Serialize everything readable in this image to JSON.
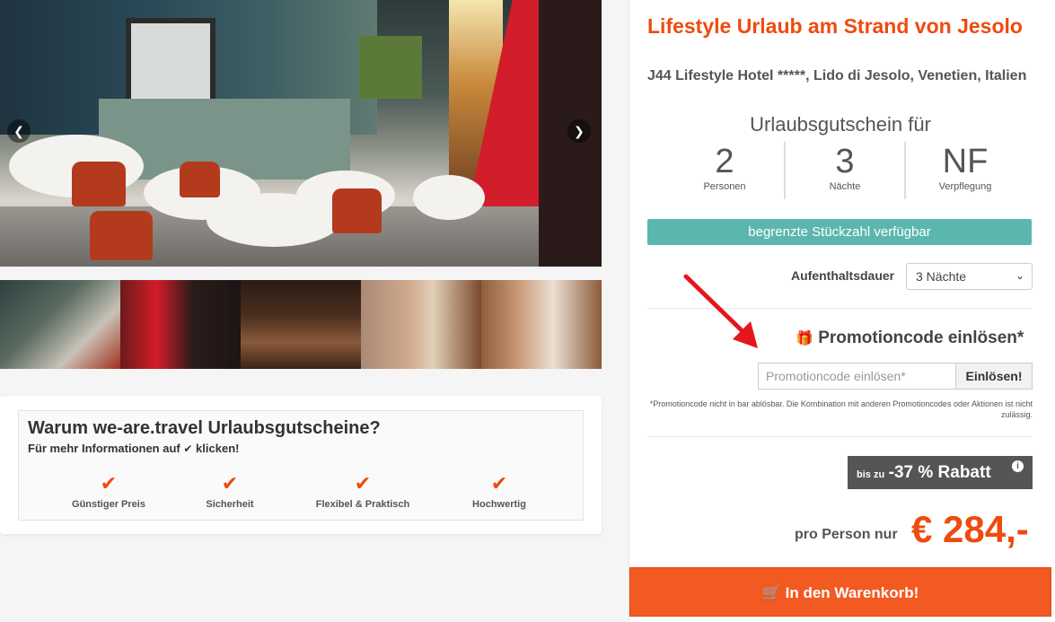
{
  "gallery": {
    "prev_icon": "chevron-left-icon",
    "next_icon": "chevron-right-icon",
    "thumbnails": [
      "restaurant",
      "bar",
      "hotel-bar",
      "lobby",
      "room"
    ]
  },
  "why": {
    "title": "Warum we-are.travel Urlaubsgutscheine?",
    "subtitle_before": "Für mehr Informationen auf",
    "subtitle_after": "klicken!",
    "items": [
      {
        "label": "Günstiger Preis"
      },
      {
        "label": "Sicherheit"
      },
      {
        "label": "Flexibel & Praktisch"
      },
      {
        "label": "Hochwertig"
      }
    ]
  },
  "offer": {
    "title": "Lifestyle Urlaub am Strand von Jesolo",
    "hotel": "J44 Lifestyle Hotel *****, Lido di Jesolo, Venetien, Italien",
    "voucher_label": "Urlaubsgutschein für",
    "stats": [
      {
        "value": "2",
        "label": "Personen"
      },
      {
        "value": "3",
        "label": "Nächte"
      },
      {
        "value": "NF",
        "label": "Verpflegung"
      }
    ],
    "limited": "begrenzte Stückzahl verfügbar",
    "stay_label": "Aufenthaltsdauer",
    "stay_value": "3 Nächte",
    "promo_title": "Promotioncode einlösen*",
    "promo_placeholder": "Promotioncode einlösen*",
    "promo_button": "Einlösen!",
    "promo_note": "*Promotioncode nicht in bar ablösbar. Die Kombination mit anderen Promotioncodes oder Aktionen ist nicht zulässig.",
    "discount_prefix": "bis zu",
    "discount_value": "-37 % Rabatt",
    "price_label": "pro Person nur",
    "price": "€ 284,-",
    "cart_button": "In den Warenkorb!"
  },
  "colors": {
    "accent": "#ee4b0f",
    "teal": "#5bb7ae",
    "cart": "#f25a22",
    "discount_bg": "#555555"
  }
}
